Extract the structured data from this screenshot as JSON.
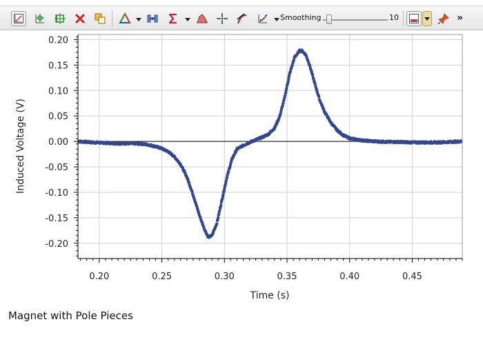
{
  "toolbar": {
    "buttons": [
      {
        "name": "graph-options-icon"
      },
      {
        "name": "autoscale-icon"
      },
      {
        "name": "autoscale-from-zero-icon"
      },
      {
        "name": "delete-data-icon"
      },
      {
        "name": "copy-graph-icon"
      },
      {
        "name": "color-palette-icon"
      },
      {
        "name": "statistics-icon"
      },
      {
        "name": "sigma-icon"
      },
      {
        "name": "integral-area-icon"
      },
      {
        "name": "examine-crosshair-icon"
      },
      {
        "name": "tangent-icon"
      },
      {
        "name": "curve-fit-icon"
      }
    ],
    "smoothing_label": "Smoothing",
    "smoothing_value": "10",
    "smoothing_level": 0.1,
    "more": "»"
  },
  "chart_data": {
    "type": "scatter",
    "xlabel": "Time (s)",
    "ylabel": "Induced Voltage (V)",
    "xlim": [
      0.183,
      0.49
    ],
    "ylim": [
      -0.23,
      0.21
    ],
    "xticks": [
      0.2,
      0.25,
      0.3,
      0.35,
      0.4,
      0.45
    ],
    "xtick_labels": [
      "0.20",
      "0.25",
      "0.30",
      "0.35",
      "0.40",
      "0.45"
    ],
    "yticks": [
      0.2,
      0.15,
      0.1,
      0.05,
      0.0,
      -0.05,
      -0.1,
      -0.15,
      -0.2
    ],
    "ytick_labels": [
      "0.20",
      "0.15",
      "0.10",
      "0.05",
      "0.00",
      "-0.05",
      "-0.10",
      "-0.15",
      "-0.20"
    ],
    "grid": true,
    "series_color": "#34478f",
    "series": [
      {
        "x": [
          0.183,
          0.195,
          0.205,
          0.215,
          0.225,
          0.235,
          0.24,
          0.245,
          0.25,
          0.255,
          0.26,
          0.265,
          0.27,
          0.275,
          0.28,
          0.284,
          0.287,
          0.29,
          0.294,
          0.298,
          0.302,
          0.306,
          0.31,
          0.315,
          0.32,
          0.325,
          0.33,
          0.335,
          0.34,
          0.344,
          0.348,
          0.352,
          0.356,
          0.36,
          0.362,
          0.365,
          0.368,
          0.372,
          0.376,
          0.38,
          0.385,
          0.39,
          0.395,
          0.4,
          0.41,
          0.42,
          0.43,
          0.44,
          0.45,
          0.46,
          0.47,
          0.48,
          0.49
        ],
        "y": [
          0.0,
          -0.002,
          -0.003,
          -0.004,
          -0.004,
          -0.005,
          -0.007,
          -0.01,
          -0.014,
          -0.02,
          -0.03,
          -0.045,
          -0.07,
          -0.105,
          -0.145,
          -0.172,
          -0.188,
          -0.185,
          -0.16,
          -0.115,
          -0.07,
          -0.035,
          -0.015,
          -0.008,
          -0.002,
          0.003,
          0.008,
          0.014,
          0.026,
          0.048,
          0.085,
          0.132,
          0.165,
          0.178,
          0.178,
          0.17,
          0.15,
          0.115,
          0.082,
          0.058,
          0.037,
          0.022,
          0.012,
          0.006,
          0.002,
          0.0,
          -0.001,
          -0.001,
          -0.002,
          -0.002,
          -0.002,
          -0.001,
          0.0
        ]
      }
    ]
  },
  "caption": "Magnet with Pole Pieces"
}
